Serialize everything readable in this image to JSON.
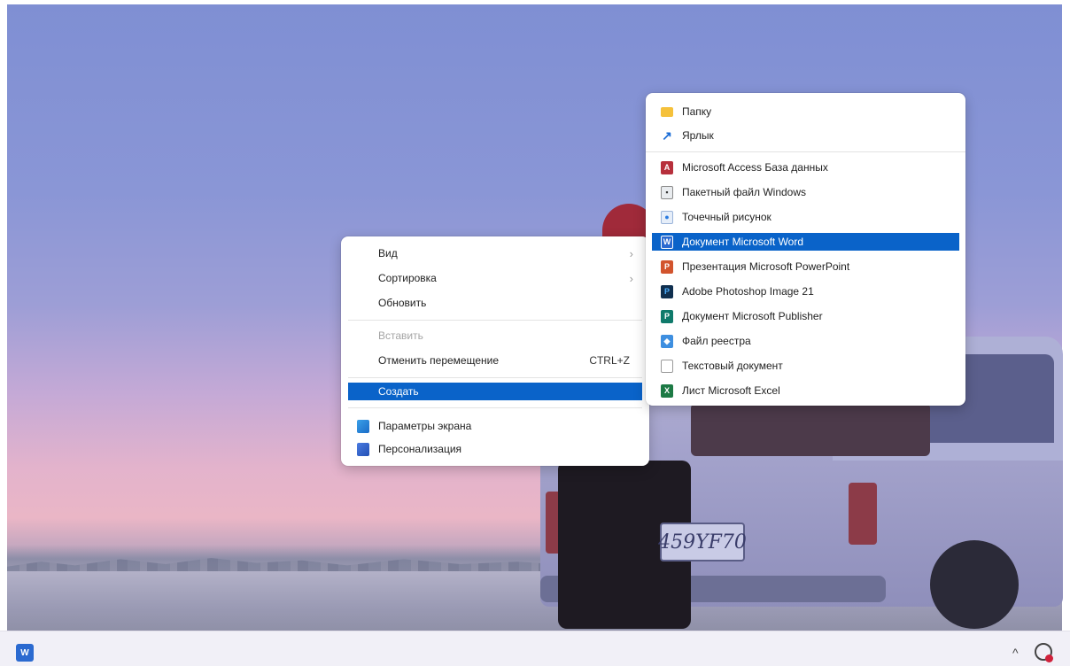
{
  "context_menu": {
    "items": [
      {
        "label": "Вид",
        "has_submenu": true
      },
      {
        "label": "Сортировка",
        "has_submenu": true
      },
      {
        "label": "Обновить"
      },
      {
        "label": "Вставить",
        "disabled": true
      },
      {
        "label": "Отменить перемещение",
        "shortcut": "CTRL+Z"
      },
      {
        "label": "Создать",
        "selected": true
      },
      {
        "label": "Параметры экрана",
        "icon": "display-settings-icon"
      },
      {
        "label": "Персонализация",
        "icon": "personalization-icon"
      }
    ]
  },
  "submenu": {
    "items": [
      {
        "label": "Папку",
        "icon": "folder-icon"
      },
      {
        "label": "Ярлык",
        "icon": "shortcut-arrow-icon"
      },
      {
        "label": "Microsoft Access База данных",
        "icon": "access-icon"
      },
      {
        "label": "Пакетный файл Windows",
        "icon": "batch-file-icon"
      },
      {
        "label": "Точечный рисунок",
        "icon": "bitmap-icon"
      },
      {
        "label": "Документ Microsoft Word",
        "icon": "word-icon",
        "selected": true
      },
      {
        "label": "Презентация Microsoft PowerPoint",
        "icon": "powerpoint-icon"
      },
      {
        "label": "Adobe Photoshop Image 21",
        "icon": "photoshop-icon"
      },
      {
        "label": "Документ Microsoft Publisher",
        "icon": "publisher-icon"
      },
      {
        "label": "Файл реестра",
        "icon": "registry-icon"
      },
      {
        "label": "Текстовый документ",
        "icon": "text-document-icon"
      },
      {
        "label": "Лист Microsoft Excel",
        "icon": "excel-icon"
      }
    ]
  },
  "wallpaper": {
    "license_plate": "459YF70"
  },
  "taskbar": {
    "app_icon": "word-icon",
    "tray_chevron": "^"
  },
  "colors": {
    "selection": "#0a63c9",
    "menu_background": "#ffffff",
    "disabled_text": "#a5a5a5"
  }
}
